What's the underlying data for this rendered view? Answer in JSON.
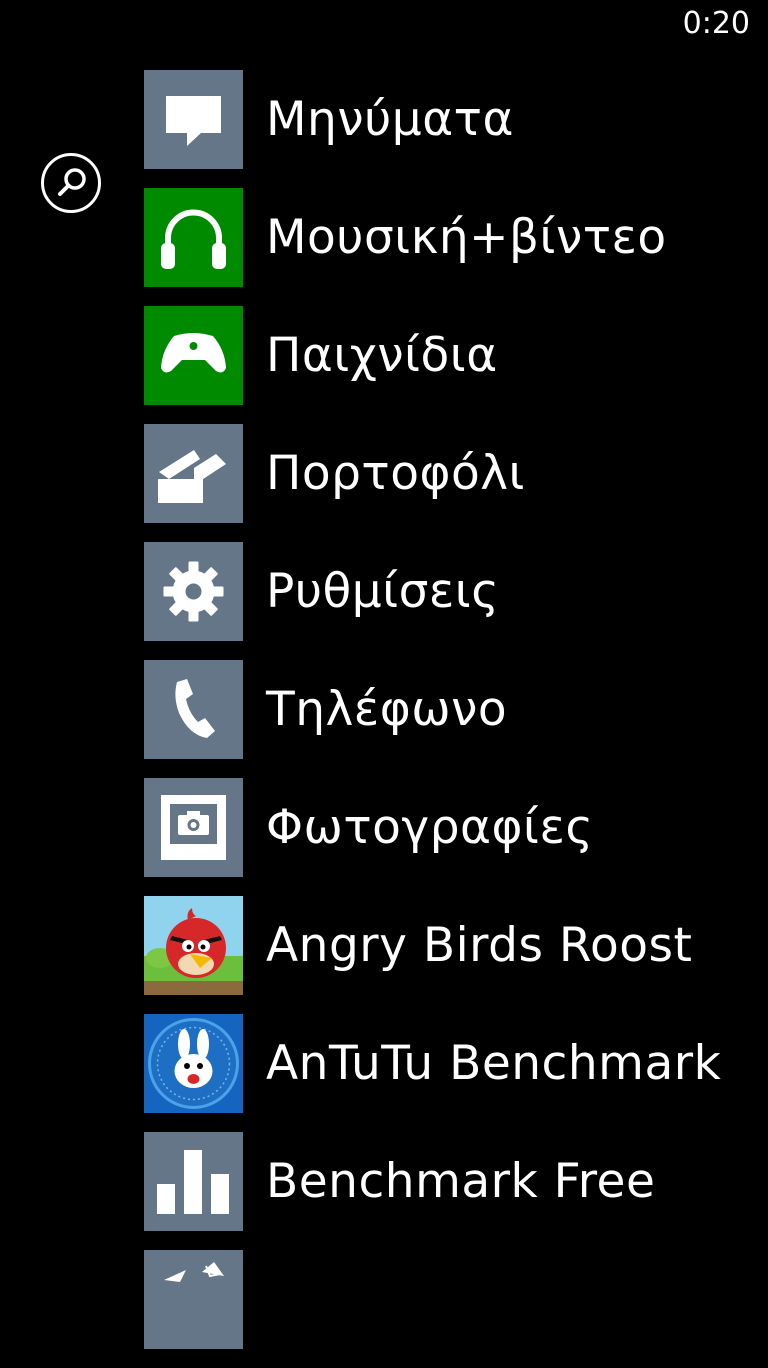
{
  "status_bar": {
    "time": "0:20"
  },
  "search": {
    "icon": "search-icon"
  },
  "apps": [
    {
      "label": "Μηνύματα",
      "icon": "message-icon",
      "tile_color": "#647687"
    },
    {
      "label": "Μουσική+βίντεο",
      "icon": "headphones-icon",
      "tile_color": "#008A00"
    },
    {
      "label": "Παιχνίδια",
      "icon": "game-controller-icon",
      "tile_color": "#008A00"
    },
    {
      "label": "Πορτοφόλι",
      "icon": "wallet-icon",
      "tile_color": "#647687"
    },
    {
      "label": "Ρυθμίσεις",
      "icon": "gear-icon",
      "tile_color": "#647687"
    },
    {
      "label": "Τηλέφωνο",
      "icon": "phone-icon",
      "tile_color": "#647687"
    },
    {
      "label": "Φωτογραφίες",
      "icon": "photo-camera-icon",
      "tile_color": "#647687"
    },
    {
      "label": "Angry Birds Roost",
      "icon": "angry-bird-icon",
      "tile_color": "#7EC8E3"
    },
    {
      "label": "AnTuTu Benchmark",
      "icon": "antutu-rabbit-icon",
      "tile_color": "#1565C0"
    },
    {
      "label": "Benchmark Free",
      "icon": "bar-chart-icon",
      "tile_color": "#647687"
    },
    {
      "label": "",
      "icon": "partial-app-icon",
      "tile_color": "#647687"
    }
  ]
}
